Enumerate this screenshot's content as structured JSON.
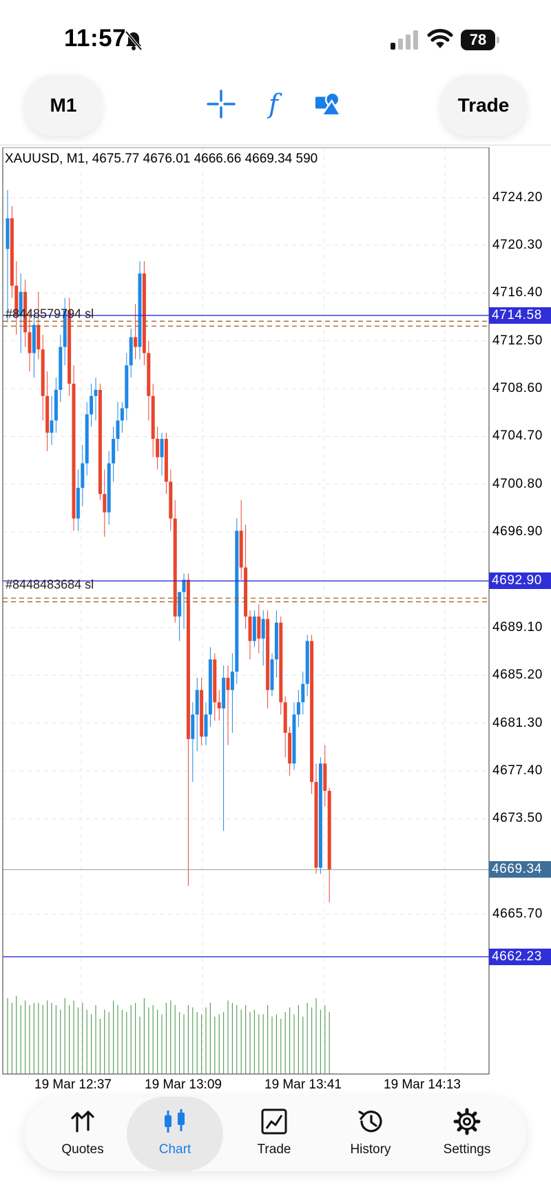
{
  "status_bar": {
    "time": "11:57",
    "battery": "78",
    "icons": [
      "bell-slash-icon",
      "cellular-signal-icon",
      "wifi-icon",
      "battery-icon"
    ]
  },
  "toolbar": {
    "timeframe_label": "M1",
    "trade_label": "Trade",
    "icons": [
      "crosshair-icon",
      "function-icon",
      "objects-icon"
    ],
    "accent_color": "#1a7ee8"
  },
  "chart": {
    "ohlc_header": "XAUUSD, M1, 4675.77 4676.01 4666.66 4669.34 590",
    "order_label_top": "#8448579794 sl",
    "order_label_mid": "#8448483684 sl",
    "y_ticks": [
      "4724.20",
      "4720.30",
      "4716.40",
      "4712.50",
      "4708.60",
      "4704.70",
      "4700.80",
      "4696.90",
      "4689.10",
      "4685.20",
      "4681.30",
      "4677.40",
      "4673.50",
      "4665.70"
    ],
    "price_tags": {
      "blue_top": "4714.58",
      "blue_mid": "4692.90",
      "current": "4669.34",
      "blue_low": "4662.23"
    },
    "x_ticks": [
      "19 Mar 12:37",
      "19 Mar 13:09",
      "19 Mar 13:41",
      "19 Mar 14:13"
    ],
    "colors": {
      "bull": "#1e88e5",
      "bear": "#e8452c",
      "order_line": "#2f2fd8",
      "sl_line": "#a0642a",
      "volume": "#5aa05a",
      "current_price_tag": "#3e6f9a"
    }
  },
  "chart_data": {
    "type": "candlestick",
    "symbol": "XAUUSD",
    "timeframe": "M1",
    "last_bar": {
      "open": 4675.77,
      "high": 4676.01,
      "low": 4666.66,
      "close": 4669.34,
      "volume": 590
    },
    "ylim": [
      4658.0,
      4727.5
    ],
    "candles": [
      {
        "o": 4720.0,
        "h": 4724.8,
        "l": 4714.0,
        "c": 4722.5
      },
      {
        "o": 4722.5,
        "h": 4723.5,
        "l": 4716.0,
        "c": 4717.0
      },
      {
        "o": 4717.0,
        "h": 4719.0,
        "l": 4713.0,
        "c": 4714.5
      },
      {
        "o": 4714.5,
        "h": 4718.0,
        "l": 4711.5,
        "c": 4716.5
      },
      {
        "o": 4716.5,
        "h": 4717.5,
        "l": 4712.0,
        "c": 4713.2
      },
      {
        "o": 4713.2,
        "h": 4715.0,
        "l": 4710.0,
        "c": 4711.5
      },
      {
        "o": 4711.5,
        "h": 4714.5,
        "l": 4709.5,
        "c": 4713.8
      },
      {
        "o": 4713.8,
        "h": 4716.5,
        "l": 4711.0,
        "c": 4711.8
      },
      {
        "o": 4711.8,
        "h": 4713.0,
        "l": 4706.0,
        "c": 4708.0
      },
      {
        "o": 4708.0,
        "h": 4710.0,
        "l": 4703.5,
        "c": 4705.0
      },
      {
        "o": 4705.0,
        "h": 4708.0,
        "l": 4704.0,
        "c": 4706.0
      },
      {
        "o": 4706.0,
        "h": 4709.5,
        "l": 4705.0,
        "c": 4708.5
      },
      {
        "o": 4708.5,
        "h": 4713.0,
        "l": 4707.5,
        "c": 4712.0
      },
      {
        "o": 4712.0,
        "h": 4716.0,
        "l": 4710.5,
        "c": 4715.0
      },
      {
        "o": 4715.0,
        "h": 4716.0,
        "l": 4708.0,
        "c": 4709.0
      },
      {
        "o": 4709.0,
        "h": 4710.5,
        "l": 4697.0,
        "c": 4698.0
      },
      {
        "o": 4698.0,
        "h": 4702.0,
        "l": 4697.0,
        "c": 4700.5
      },
      {
        "o": 4700.5,
        "h": 4704.0,
        "l": 4699.0,
        "c": 4702.5
      },
      {
        "o": 4702.5,
        "h": 4707.5,
        "l": 4701.5,
        "c": 4706.5
      },
      {
        "o": 4706.5,
        "h": 4709.0,
        "l": 4705.5,
        "c": 4708.0
      },
      {
        "o": 4708.0,
        "h": 4709.5,
        "l": 4706.0,
        "c": 4708.5
      },
      {
        "o": 4708.5,
        "h": 4709.0,
        "l": 4699.5,
        "c": 4700.0
      },
      {
        "o": 4700.0,
        "h": 4702.0,
        "l": 4696.5,
        "c": 4698.5
      },
      {
        "o": 4698.5,
        "h": 4703.5,
        "l": 4697.5,
        "c": 4702.5
      },
      {
        "o": 4702.5,
        "h": 4705.5,
        "l": 4701.0,
        "c": 4704.5
      },
      {
        "o": 4704.5,
        "h": 4707.5,
        "l": 4703.5,
        "c": 4706.0
      },
      {
        "o": 4706.0,
        "h": 4707.5,
        "l": 4705.0,
        "c": 4707.0
      },
      {
        "o": 4707.0,
        "h": 4711.5,
        "l": 4706.0,
        "c": 4710.5
      },
      {
        "o": 4710.5,
        "h": 4713.5,
        "l": 4709.5,
        "c": 4712.8
      },
      {
        "o": 4712.8,
        "h": 4715.5,
        "l": 4711.0,
        "c": 4712.0
      },
      {
        "o": 4712.0,
        "h": 4719.0,
        "l": 4711.0,
        "c": 4718.0
      },
      {
        "o": 4718.0,
        "h": 4719.0,
        "l": 4710.5,
        "c": 4711.5
      },
      {
        "o": 4711.5,
        "h": 4712.5,
        "l": 4706.0,
        "c": 4708.0
      },
      {
        "o": 4708.0,
        "h": 4709.0,
        "l": 4703.0,
        "c": 4704.5
      },
      {
        "o": 4704.5,
        "h": 4705.5,
        "l": 4702.0,
        "c": 4703.0
      },
      {
        "o": 4703.0,
        "h": 4705.0,
        "l": 4701.5,
        "c": 4704.5
      },
      {
        "o": 4704.5,
        "h": 4705.0,
        "l": 4700.0,
        "c": 4701.0
      },
      {
        "o": 4701.0,
        "h": 4702.0,
        "l": 4697.0,
        "c": 4698.0
      },
      {
        "o": 4698.0,
        "h": 4699.5,
        "l": 4689.5,
        "c": 4690.0
      },
      {
        "o": 4690.0,
        "h": 4691.5,
        "l": 4688.0,
        "c": 4692.0
      },
      {
        "o": 4692.0,
        "h": 4693.5,
        "l": 4689.0,
        "c": 4693.0
      },
      {
        "o": 4693.0,
        "h": 4693.5,
        "l": 4668.0,
        "c": 4680.0
      },
      {
        "o": 4680.0,
        "h": 4683.0,
        "l": 4676.5,
        "c": 4682.0
      },
      {
        "o": 4682.0,
        "h": 4685.0,
        "l": 4679.0,
        "c": 4684.0
      },
      {
        "o": 4684.0,
        "h": 4685.0,
        "l": 4679.5,
        "c": 4680.2
      },
      {
        "o": 4680.2,
        "h": 4683.0,
        "l": 4679.5,
        "c": 4682.0
      },
      {
        "o": 4682.0,
        "h": 4687.5,
        "l": 4681.0,
        "c": 4686.5
      },
      {
        "o": 4686.5,
        "h": 4687.0,
        "l": 4681.5,
        "c": 4683.0
      },
      {
        "o": 4683.0,
        "h": 4684.0,
        "l": 4681.5,
        "c": 4682.5
      },
      {
        "o": 4682.5,
        "h": 4686.0,
        "l": 4672.5,
        "c": 4685.0
      },
      {
        "o": 4685.0,
        "h": 4686.0,
        "l": 4679.5,
        "c": 4684.0
      },
      {
        "o": 4684.0,
        "h": 4687.0,
        "l": 4680.5,
        "c": 4685.5
      },
      {
        "o": 4685.5,
        "h": 4698.0,
        "l": 4684.5,
        "c": 4697.0
      },
      {
        "o": 4697.0,
        "h": 4699.5,
        "l": 4693.0,
        "c": 4694.0
      },
      {
        "o": 4694.0,
        "h": 4697.5,
        "l": 4689.0,
        "c": 4690.0
      },
      {
        "o": 4690.0,
        "h": 4690.5,
        "l": 4686.5,
        "c": 4688.0
      },
      {
        "o": 4688.0,
        "h": 4690.5,
        "l": 4687.5,
        "c": 4690.0
      },
      {
        "o": 4690.0,
        "h": 4691.0,
        "l": 4687.0,
        "c": 4688.2
      },
      {
        "o": 4688.2,
        "h": 4690.5,
        "l": 4686.0,
        "c": 4689.8
      },
      {
        "o": 4689.8,
        "h": 4690.5,
        "l": 4682.5,
        "c": 4684.0
      },
      {
        "o": 4684.0,
        "h": 4687.0,
        "l": 4683.5,
        "c": 4686.5
      },
      {
        "o": 4686.5,
        "h": 4690.5,
        "l": 4685.0,
        "c": 4689.5
      },
      {
        "o": 4689.5,
        "h": 4690.0,
        "l": 4682.0,
        "c": 4683.0
      },
      {
        "o": 4683.0,
        "h": 4683.5,
        "l": 4678.5,
        "c": 4680.5
      },
      {
        "o": 4680.5,
        "h": 4681.0,
        "l": 4677.0,
        "c": 4678.0
      },
      {
        "o": 4678.0,
        "h": 4683.0,
        "l": 4677.5,
        "c": 4682.0
      },
      {
        "o": 4682.0,
        "h": 4684.0,
        "l": 4681.0,
        "c": 4683.0
      },
      {
        "o": 4683.0,
        "h": 4685.5,
        "l": 4682.0,
        "c": 4684.5
      },
      {
        "o": 4684.5,
        "h": 4688.5,
        "l": 4683.5,
        "c": 4688.0
      },
      {
        "o": 4688.0,
        "h": 4688.5,
        "l": 4675.5,
        "c": 4676.5
      },
      {
        "o": 4676.5,
        "h": 4678.0,
        "l": 4669.0,
        "c": 4669.5
      },
      {
        "o": 4669.5,
        "h": 4678.5,
        "l": 4669.0,
        "c": 4678.0
      },
      {
        "o": 4678.0,
        "h": 4679.5,
        "l": 4674.5,
        "c": 4675.77
      },
      {
        "o": 4675.77,
        "h": 4676.01,
        "l": 4666.66,
        "c": 4669.34
      }
    ],
    "volume": [
      330,
      310,
      340,
      300,
      320,
      300,
      310,
      310,
      300,
      320,
      310,
      300,
      280,
      330,
      300,
      320,
      290,
      310,
      280,
      260,
      300,
      240,
      280,
      270,
      320,
      300,
      280,
      270,
      300,
      310,
      250,
      330,
      290,
      300,
      280,
      260,
      310,
      320,
      300,
      270,
      260,
      300,
      290,
      270,
      260,
      290,
      310,
      250,
      260,
      270,
      320,
      310,
      300,
      280,
      300,
      270,
      280,
      260,
      260,
      300,
      250,
      260,
      240,
      270,
      290,
      260,
      300,
      250,
      310,
      290,
      330,
      280,
      300,
      270
    ],
    "volume_ylim": [
      0,
      420
    ],
    "order_lines": [
      {
        "price": 4714.58,
        "color": "blue"
      },
      {
        "price": 4692.9,
        "color": "blue"
      },
      {
        "price": 4662.23,
        "color": "blue"
      }
    ],
    "sl_lines": [
      4714.1,
      4713.7,
      4691.5,
      4691.2
    ],
    "current_price": 4669.34,
    "grid": true
  },
  "bottom_nav": {
    "items": [
      {
        "label": "Quotes",
        "icon": "quotes-arrows-icon",
        "active": false
      },
      {
        "label": "Chart",
        "icon": "candlestick-chart-icon",
        "active": true
      },
      {
        "label": "Trade",
        "icon": "trade-chart-icon",
        "active": false
      },
      {
        "label": "History",
        "icon": "history-clock-icon",
        "active": false
      },
      {
        "label": "Settings",
        "icon": "settings-gear-icon",
        "active": false
      }
    ]
  }
}
